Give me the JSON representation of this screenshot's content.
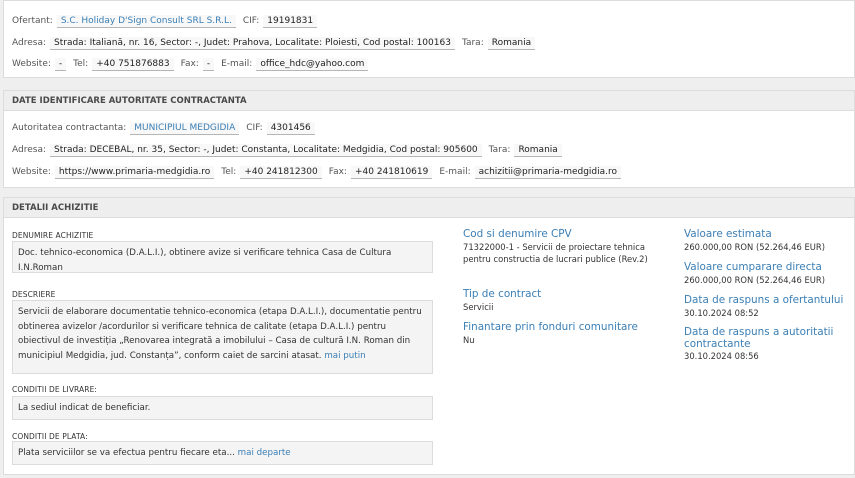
{
  "ofertant": {
    "ofertant_label": "Ofertant:",
    "ofertant_value": "S.C. Holiday D'Sign Consult SRL S.R.L.",
    "cif_label": "CIF:",
    "cif_value": "19191831",
    "adresa_label": "Adresa:",
    "adresa_value": "Strada: Italiană, nr. 16, Sector: -, Judet: Prahova, Localitate: Ploiesti, Cod postal: 100163",
    "tara_label": "Tara:",
    "tara_value": "Romania",
    "website_label": "Website:",
    "website_value": "-",
    "tel_label": "Tel:",
    "tel_value": "+40 751876883",
    "fax_label": "Fax:",
    "fax_value": "-",
    "email_label": "E-mail:",
    "email_value": "office_hdc@yahoo.com"
  },
  "autoritate": {
    "header": "DATE IDENTIFICARE AUTORITATE CONTRACTANTA",
    "autoritate_label": "Autoritatea contractanta:",
    "autoritate_value": "MUNICIPIUL MEDGIDIA",
    "cif_label": "CIF:",
    "cif_value": "4301456",
    "adresa_label": "Adresa:",
    "adresa_value": "Strada: DECEBAL, nr. 35, Sector: -, Judet: Constanta, Localitate: Medgidia, Cod postal: 905600",
    "tara_label": "Tara:",
    "tara_value": "Romania",
    "website_label": "Website:",
    "website_value": "https://www.primaria-medgidia.ro",
    "tel_label": "Tel:",
    "tel_value": "+40 241812300",
    "fax_label": "Fax:",
    "fax_value": "+40 241810619",
    "email_label": "E-mail:",
    "email_value": "achizitii@primaria-medgidia.ro"
  },
  "detalii": {
    "header": "DETALII ACHIZITIE",
    "denumire_label": "DENUMIRE ACHIZITIE",
    "denumire_value": "Doc. tehnico-economica (D.A.L.I.), obtinere avize si verificare tehnica Casa de Cultura I.N.Roman",
    "descriere_label": "DESCRIERE",
    "descriere_value": "Servicii de elaborare documentatie tehnico-economica (etapa D.A.L.I.), documentatie pentru obtinerea avizelor /acordurilor si verificare tehnica de calitate (etapa D.A.L.I.) pentru obiectivul de investiția „Renovarea integrată a imobilului – Casa de cultură I.N. Roman din municipiul Medgidia, jud. Constanța”, conform caiet de sarcini atasat.",
    "descriere_more": "mai putin",
    "livrare_label": "CONDITII DE LIVRARE:",
    "livrare_value": "La sediul indicat de beneficiar.",
    "plata_label": "CONDITII DE PLATA:",
    "plata_value": "Plata serviciilor se va efectua pentru fiecare eta...",
    "plata_more": "mai departe",
    "cpv_title": "Cod si denumire CPV",
    "cpv_value": "71322000-1 - Servicii de proiectare tehnica pentru constructia de lucrari publice (Rev.2)",
    "tip_title": "Tip de contract",
    "tip_value": "Servicii",
    "fonduri_title": "Finantare prin fonduri comunitare",
    "fonduri_value": "Nu",
    "val_estimata_title": "Valoare estimata",
    "val_estimata_value": "260.000,00 RON (52.264,46 EUR)",
    "val_directa_title": "Valoare cumparare directa",
    "val_directa_value": "260.000,00 RON (52.264,46 EUR)",
    "raspuns_ofertant_title": "Data de raspuns a ofertantului",
    "raspuns_ofertant_value": "30.10.2024 08:52",
    "raspuns_autoritate_title": "Data de raspuns a autoritatii contractante",
    "raspuns_autoritate_value": "30.10.2024 08:56"
  }
}
